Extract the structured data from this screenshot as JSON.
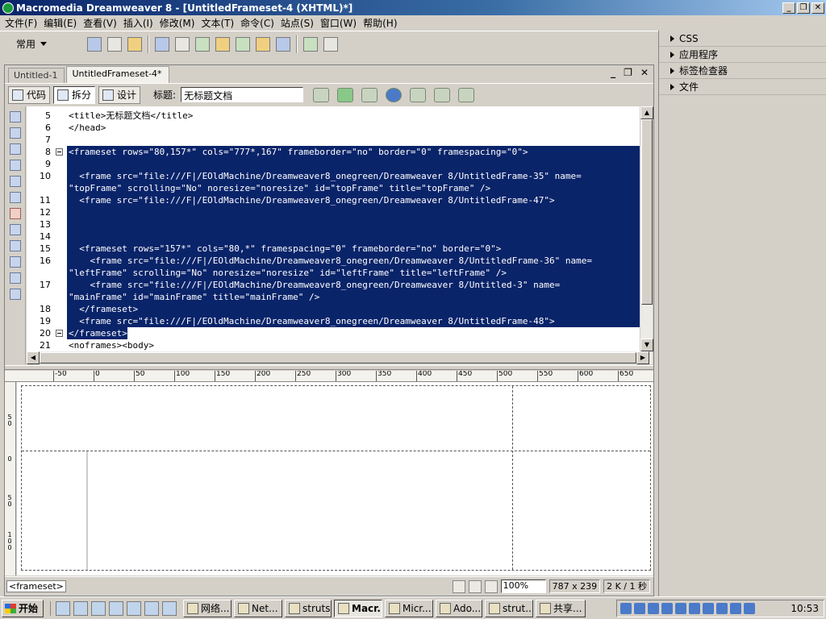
{
  "window": {
    "title": "Macromedia Dreamweaver 8 - [UntitledFrameset-4 (XHTML)*]",
    "minimize": "_",
    "restore": "❐",
    "close": "✕"
  },
  "menu": [
    "文件(F)",
    "编辑(E)",
    "查看(V)",
    "插入(I)",
    "修改(M)",
    "文本(T)",
    "命令(C)",
    "站点(S)",
    "窗口(W)",
    "帮助(H)"
  ],
  "insert_bar": {
    "category": "常用",
    "icons": [
      "hyperlink-icon",
      "email-link-icon",
      "named-anchor-icon",
      "table-icon",
      "layer-icon",
      "image-icon",
      "media-icon",
      "date-icon",
      "comment-icon",
      "template-icon",
      "tag-chooser-icon"
    ]
  },
  "right_panel": [
    "CSS",
    "应用程序",
    "标签检查器",
    "文件"
  ],
  "tabs": [
    {
      "label": "Untitled-1",
      "active": false
    },
    {
      "label": "UntitledFrameset-4*",
      "active": true
    }
  ],
  "doc_controls": {
    "minimize": "_",
    "restore": "❐",
    "close": "✕"
  },
  "doc_toolbar": {
    "code_label": "代码",
    "split_label": "拆分",
    "design_label": "设计",
    "title_label": "标题:",
    "title_value": "无标题文档"
  },
  "code": {
    "lines": [
      {
        "num": "5",
        "text": "<title>无标题文档</title>",
        "selected": false,
        "fold": false
      },
      {
        "num": "6",
        "text": "</head>",
        "selected": false,
        "fold": false
      },
      {
        "num": "7",
        "text": "",
        "selected": false,
        "fold": false
      },
      {
        "num": "8",
        "text": "<frameset rows=\"80,157*\" cols=\"777*,167\" frameborder=\"no\" border=\"0\" framespacing=\"0\">",
        "selected": true,
        "fold": true
      },
      {
        "num": "9",
        "text": "",
        "selected": true,
        "fold": false
      },
      {
        "num": "10",
        "text": "  <frame src=\"file:///F|/EOldMachine/Dreamweaver8_onegreen/Dreamweaver 8/UntitledFrame-35\" name=",
        "selected": true,
        "fold": false
      },
      {
        "num": "",
        "text": "\"topFrame\" scrolling=\"No\" noresize=\"noresize\" id=\"topFrame\" title=\"topFrame\" />",
        "selected": true,
        "fold": false
      },
      {
        "num": "11",
        "text": "  <frame src=\"file:///F|/EOldMachine/Dreamweaver8_onegreen/Dreamweaver 8/UntitledFrame-47\">",
        "selected": true,
        "fold": false
      },
      {
        "num": "12",
        "text": "",
        "selected": true,
        "fold": false
      },
      {
        "num": "13",
        "text": "",
        "selected": true,
        "fold": false
      },
      {
        "num": "14",
        "text": "",
        "selected": true,
        "fold": false
      },
      {
        "num": "15",
        "text": "  <frameset rows=\"157*\" cols=\"80,*\" framespacing=\"0\" frameborder=\"no\" border=\"0\">",
        "selected": true,
        "fold": false
      },
      {
        "num": "16",
        "text": "    <frame src=\"file:///F|/EOldMachine/Dreamweaver8_onegreen/Dreamweaver 8/UntitledFrame-36\" name=",
        "selected": true,
        "fold": false
      },
      {
        "num": "",
        "text": "\"leftFrame\" scrolling=\"No\" noresize=\"noresize\" id=\"leftFrame\" title=\"leftFrame\" />",
        "selected": true,
        "fold": false
      },
      {
        "num": "17",
        "text": "    <frame src=\"file:///F|/EOldMachine/Dreamweaver8_onegreen/Dreamweaver 8/Untitled-3\" name=",
        "selected": true,
        "fold": false
      },
      {
        "num": "",
        "text": "\"mainFrame\" id=\"mainFrame\" title=\"mainFrame\" />",
        "selected": true,
        "fold": false
      },
      {
        "num": "18",
        "text": "  </frameset>",
        "selected": true,
        "fold": false
      },
      {
        "num": "19",
        "text": "  <frame src=\"file:///F|/EOldMachine/Dreamweaver8_onegreen/Dreamweaver 8/UntitledFrame-48\">",
        "selected": true,
        "fold": false
      },
      {
        "num": "20",
        "text": "</frameset>",
        "selected": "partial",
        "fold": true
      },
      {
        "num": "21",
        "text": "<noframes><body>",
        "selected": false,
        "fold": false
      }
    ]
  },
  "ruler": {
    "top": [
      "-50",
      "0",
      "50",
      "100",
      "150",
      "200",
      "250",
      "300",
      "350",
      "400",
      "450",
      "500",
      "550",
      "600",
      "650"
    ],
    "left": [
      "5\n0",
      "0",
      "5\n0",
      "1\n0\n0"
    ]
  },
  "status": {
    "tag": "<frameset>",
    "zoom": "100%",
    "size": "787 x 239",
    "download": "2 K / 1 秒"
  },
  "taskbar": {
    "start": "开始",
    "tasks": [
      {
        "label": "网络...",
        "active": false
      },
      {
        "label": "Net...",
        "active": false
      },
      {
        "label": "struts",
        "active": false
      },
      {
        "label": "Macr...",
        "active": true
      },
      {
        "label": "Micr...",
        "active": false
      },
      {
        "label": "Ado...",
        "active": false
      },
      {
        "label": "strut...",
        "active": false
      },
      {
        "label": "共享...",
        "active": false
      }
    ],
    "clock": "10:53"
  }
}
